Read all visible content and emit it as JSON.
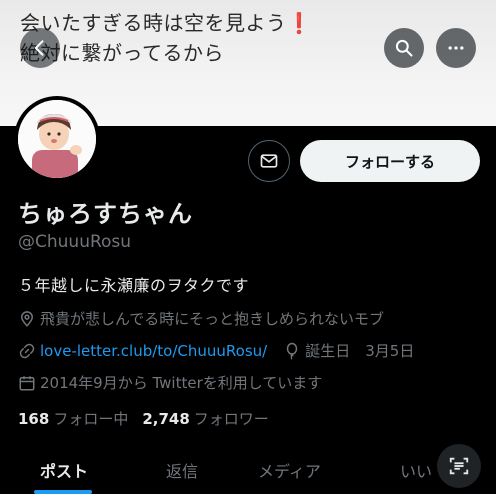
{
  "banner": {
    "line1": "会いたすぎる時は空を見よう",
    "line1_mark": "❗",
    "line2": "絶対に繋がってるから"
  },
  "profile": {
    "display_name": "ちゅろすちゃん",
    "handle": "@ChuuuRosu",
    "bio": "５年越しに永瀬廉のヲタクです",
    "location": "飛貴が悲しんでる時にそっと抱きしめられないモブ",
    "link": "love-letter.club/to/ChuuuRosu/",
    "birthday": "誕生日　3月5日",
    "joined": "2014年9月から Twitterを利用しています"
  },
  "actions": {
    "follow_label": "フォローする"
  },
  "stats": {
    "following_count": "168",
    "following_label": "フォロー中",
    "followers_count": "2,748",
    "followers_label": "フォロワー"
  },
  "tabs": [
    {
      "label": "ポスト"
    },
    {
      "label": "返信"
    },
    {
      "label": "メディア"
    },
    {
      "label": "いい"
    }
  ],
  "icons": {
    "back": "arrow-left-icon",
    "search": "search-icon",
    "more": "more-icon",
    "mail": "mail-icon",
    "location": "location-icon",
    "link": "link-icon",
    "birthday": "balloon-icon",
    "calendar": "calendar-icon",
    "scan": "scan-text-icon"
  },
  "colors": {
    "accent": "#1d9bf0",
    "background": "#000000",
    "secondary_text": "#71767b",
    "primary_text": "#e7e9ea"
  }
}
